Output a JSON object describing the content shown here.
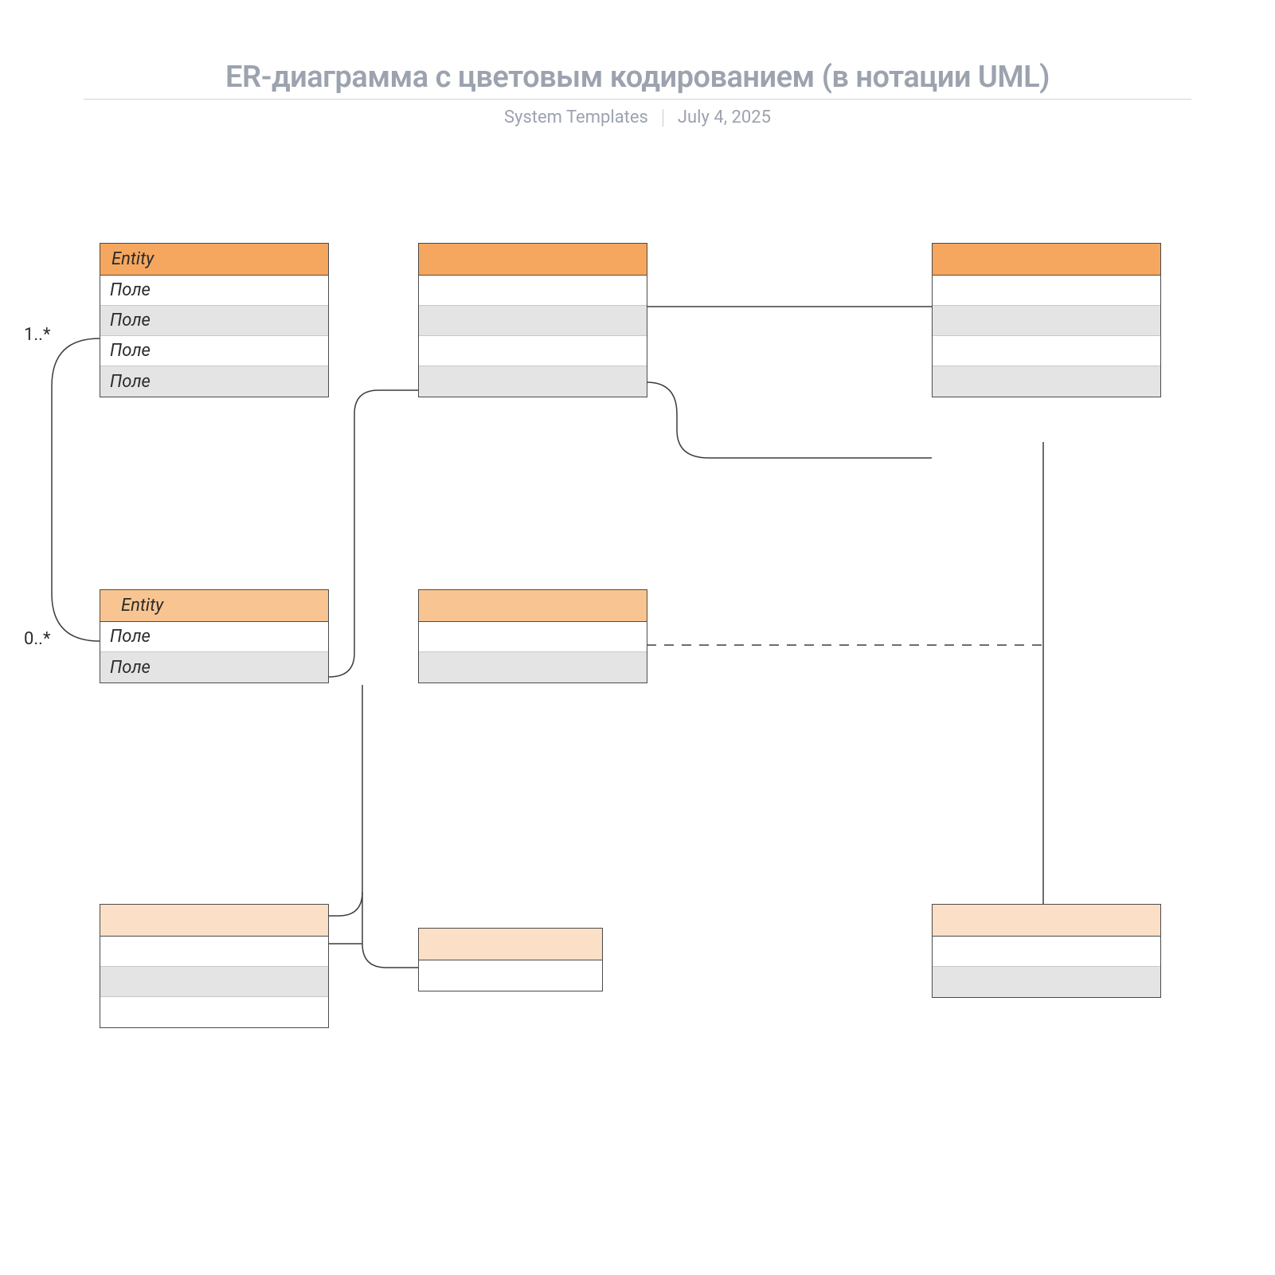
{
  "header": {
    "title": "ER-диаграмма с цветовым кодированием (в нотации UML)",
    "subtitle_left": "System Templates",
    "subtitle_right": "July 4, 2025"
  },
  "multiplicities": {
    "top": "1..*",
    "bottom": "0..*"
  },
  "entities": {
    "e1": {
      "title": "Entity",
      "fields": [
        "Поле",
        "Поле",
        "Поле",
        "Поле"
      ]
    },
    "e2": {
      "title": "Entity",
      "fields": [
        "Поле",
        "Поле"
      ]
    },
    "e3": {
      "title": "",
      "fields": [
        "",
        "",
        "",
        ""
      ]
    },
    "e4": {
      "title": "",
      "fields": [
        "",
        "",
        "",
        ""
      ]
    },
    "e5": {
      "title": "",
      "fields": [
        "",
        ""
      ]
    },
    "e6": {
      "title": "",
      "fields": [
        "",
        "",
        ""
      ]
    },
    "e7": {
      "title": "",
      "fields": [
        ""
      ]
    },
    "e8": {
      "title": "",
      "fields": [
        "",
        ""
      ]
    }
  },
  "colors": {
    "orange_dark": "#f5a75f",
    "orange_mid": "#f8c592",
    "orange_lite": "#fbe0c7",
    "row_alt": "#e4e4e4",
    "border": "#4b4b4b",
    "title_grey": "#9ca3af"
  }
}
